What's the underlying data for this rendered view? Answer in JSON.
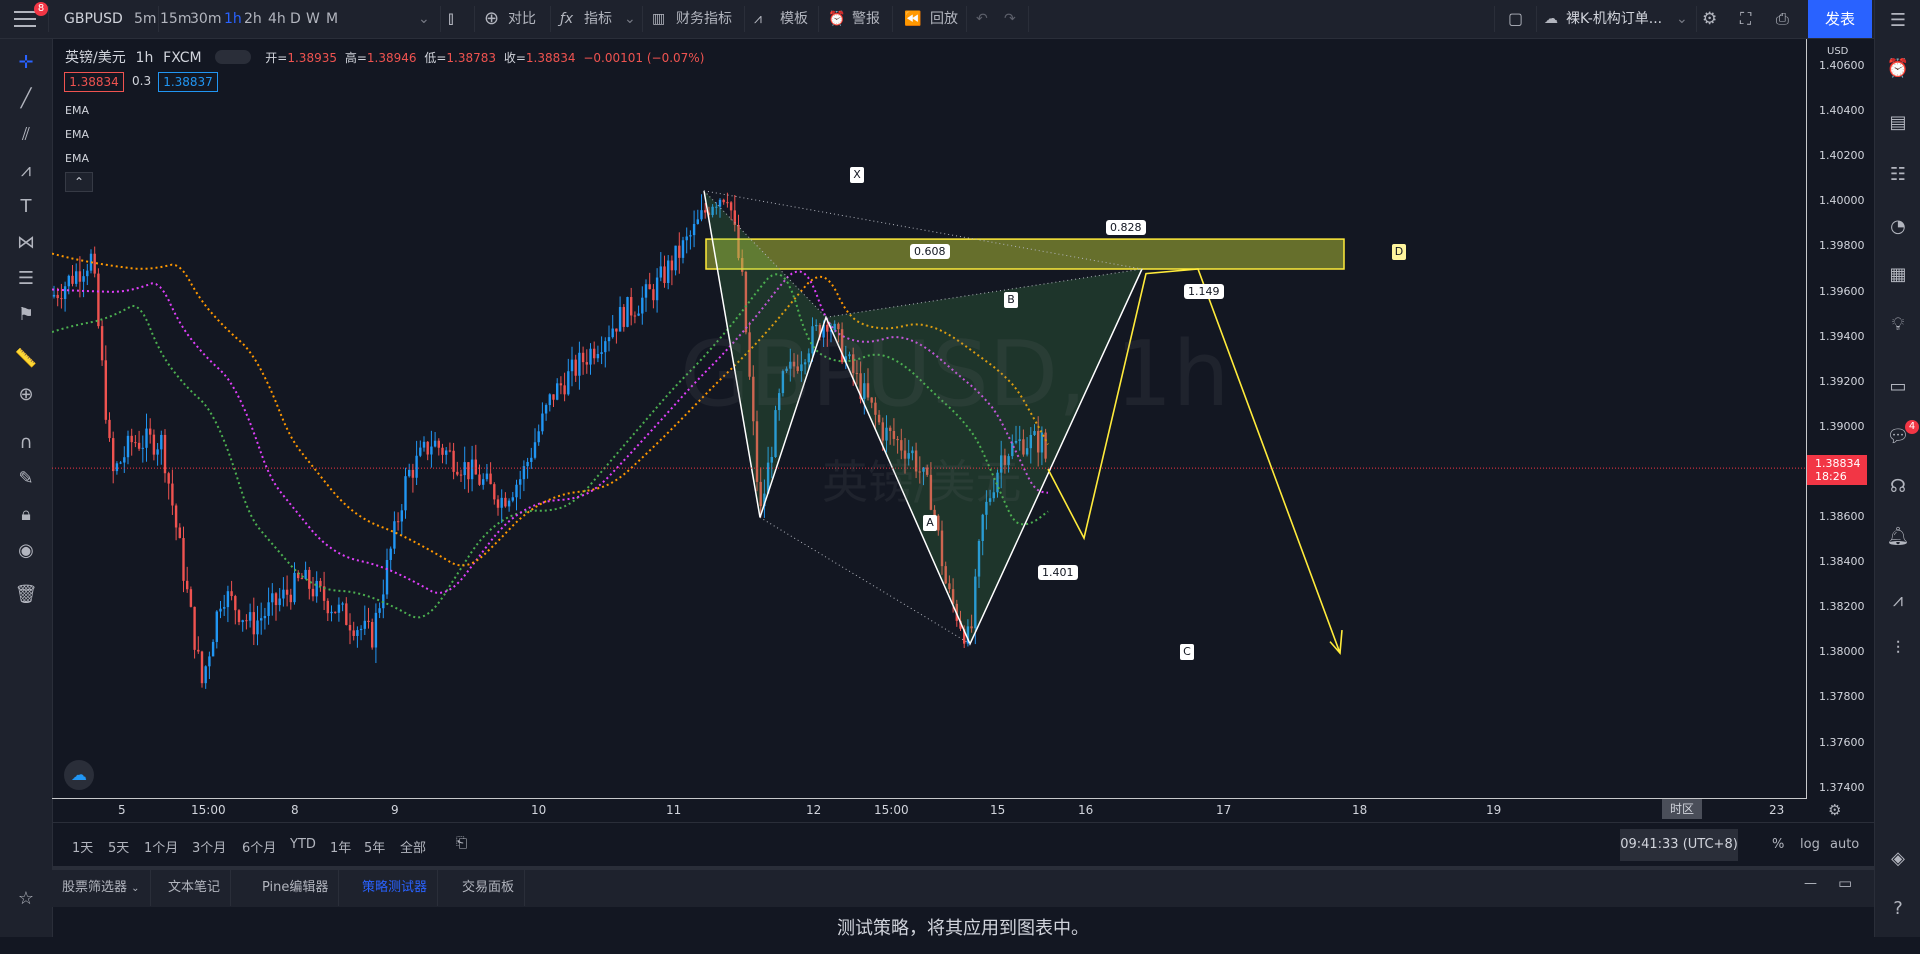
{
  "toolbar": {
    "menu_badge": "8",
    "symbol": "GBPUSD",
    "intervals": [
      "5m",
      "15m",
      "30m",
      "1h",
      "2h",
      "4h",
      "D",
      "W",
      "M"
    ],
    "active_interval": "1h",
    "compare": "对比",
    "indicators": "指标",
    "financials": "财务指标",
    "templates": "模板",
    "alert": "警报",
    "replay": "回放",
    "layout_name": "裸K-机构订单...",
    "publish": "发表"
  },
  "legend": {
    "title": "英镑/美元",
    "interval": "1h",
    "exchange": "FXCM",
    "open_label": "开=",
    "open": "1.38935",
    "high_label": "高=",
    "high": "1.38946",
    "low_label": "低=",
    "low": "1.38783",
    "close_label": "收=",
    "close": "1.38834",
    "change": "−0.00101 (−0.07%)",
    "bid": "1.38834",
    "spread": "0.3",
    "ask": "1.38837",
    "indicators": [
      "EMA",
      "EMA",
      "EMA"
    ]
  },
  "watermark": {
    "symbol": "GBPUSD, 1h",
    "name": "英镑/美元"
  },
  "price_axis": {
    "currency": "USD",
    "ticks": [
      "1.40600",
      "1.40400",
      "1.40200",
      "1.40000",
      "1.39800",
      "1.39600",
      "1.39400",
      "1.39200",
      "1.39000",
      "1.38800",
      "1.38600",
      "1.38400",
      "1.38200",
      "1.38000",
      "1.37800",
      "1.37600",
      "1.37400"
    ],
    "current_price": "1.38834",
    "countdown": "18:26"
  },
  "time_axis": {
    "ticks": [
      "5",
      "15:00",
      "8",
      "9",
      "10",
      "11",
      "12",
      "15:00",
      "15",
      "16",
      "17",
      "18",
      "19",
      "23"
    ],
    "timezone_button": "时区"
  },
  "pattern": {
    "points": [
      "X",
      "A",
      "B",
      "C",
      "D"
    ],
    "ratios": [
      "0.828",
      "0.608",
      "1.149",
      "1.401"
    ]
  },
  "colors": {
    "up": "#2196f3",
    "down": "#ef5350",
    "ema_fast": "#ff9800",
    "ema_mid": "#e040fb",
    "ema_slow": "#4caf50",
    "zone": "#ffeb3b",
    "accent": "#2962ff"
  },
  "range_bar": {
    "ranges": [
      "1天",
      "5天",
      "1个月",
      "3个月",
      "6个月",
      "YTD",
      "1年",
      "5年",
      "全部"
    ],
    "clock": "09:41:33 (UTC+8)",
    "percent": "%",
    "log": "log",
    "auto": "auto"
  },
  "bottom_tabs": [
    "股票筛选器",
    "文本笔记",
    "Pine编辑器",
    "策略测试器",
    "交易面板"
  ],
  "active_bottom_tab": "策略测试器",
  "panel_message": "测试策略，将其应用到图表中。",
  "right_badge": "4",
  "chart_data": {
    "type": "candlestick",
    "title": "英镑/美元",
    "ylim": [
      1.374,
      1.407
    ],
    "xlabels": [
      "5",
      "15:00",
      "8",
      "9",
      "10",
      "11",
      "12",
      "15:00",
      "15",
      "16",
      "17",
      "18",
      "19",
      "23"
    ],
    "pattern_points": {
      "X": 1.4004,
      "A": 1.3862,
      "B": 1.3949,
      "C": 1.3807,
      "D": 1.397
    },
    "zone": [
      1.397,
      1.3983
    ],
    "last_price": 1.38834
  }
}
